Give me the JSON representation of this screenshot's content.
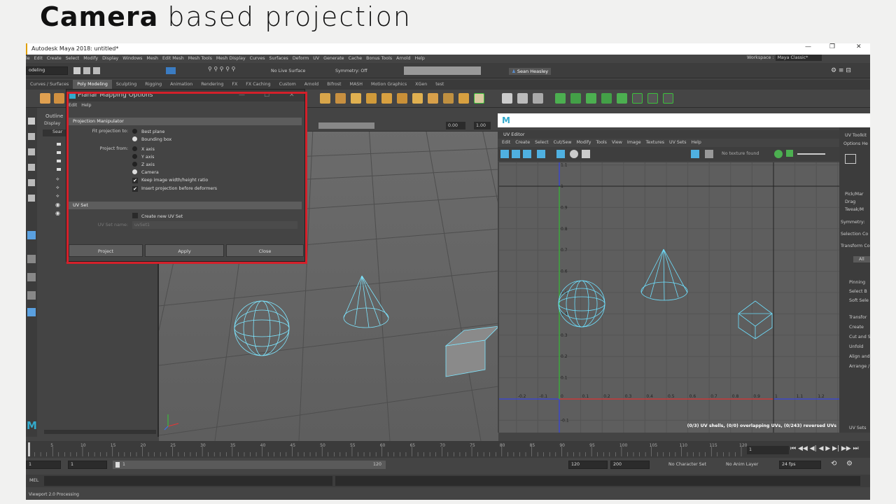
{
  "slide": {
    "title_bold": "Camera",
    "title_light": "based projection"
  },
  "window": {
    "title": "Autodesk Maya 2018: untitled*",
    "minimize": "—",
    "restore": "❐",
    "close": "✕"
  },
  "menus": [
    "le",
    "Edit",
    "Create",
    "Select",
    "Modify",
    "Display",
    "Windows",
    "Mesh",
    "Edit Mesh",
    "Mesh Tools",
    "Mesh Display",
    "Curves",
    "Surfaces",
    "Deform",
    "UV",
    "Generate",
    "Cache",
    "Bonus Tools",
    "Arnold",
    "Help"
  ],
  "workspace": {
    "label": "Workspace :",
    "value": "Maya Classic*"
  },
  "status": {
    "mode": "odeling",
    "live": "No Live Surface",
    "symmetry": "Symmetry: Off",
    "user": "Sean Heasley"
  },
  "shelf_tabs": [
    "Curves / Surfaces",
    "Poly Modeling",
    "Sculpting",
    "Rigging",
    "Animation",
    "Rendering",
    "FX",
    "FX Caching",
    "Custom",
    "Arnold",
    "Bifrost",
    "MASH",
    "Motion Graphics",
    "XGen",
    "test"
  ],
  "shelf_active": "Poly Modeling",
  "outliner": {
    "title": "Outline",
    "menu": "Display",
    "search": "Sear"
  },
  "viewport": {
    "field1": "0.00",
    "field2": "1.00"
  },
  "dialog": {
    "title": "Planar Mapping Options",
    "menu": [
      "Edit",
      "Help"
    ],
    "section1": "Projection Manipulator",
    "fit_label": "Fit projection to:",
    "fit_options": [
      "Best plane",
      "Bounding box"
    ],
    "project_label": "Project from:",
    "project_options": [
      "X axis",
      "Y axis",
      "Z axis",
      "Camera"
    ],
    "keep_ratio": "Keep image width/height ratio",
    "insert_proj": "Insert projection before deformers",
    "section2": "UV Set",
    "create_uv": "Create new UV Set",
    "uvset_label": "UV Set name:",
    "uvset_value": "uvSet1",
    "buttons": [
      "Project",
      "Apply",
      "Close"
    ]
  },
  "uv_editor": {
    "title": "UV Editor",
    "menu": [
      "Edit",
      "Create",
      "Select",
      "Cut/Sew",
      "Modify",
      "Tools",
      "View",
      "Image",
      "Textures",
      "UV Sets",
      "Help"
    ],
    "texture": "No texture found",
    "status": "(0/3) UV shells, (0/0) overlapping UVs, (0/243) reversed UVs",
    "x_ticks": [
      "-0.2",
      "-0.1",
      "0",
      "0.1",
      "0.2",
      "0.3",
      "0.4",
      "0.5",
      "0.6",
      "0.7",
      "0.8",
      "0.9",
      "1",
      "1.1",
      "1.2"
    ],
    "y_ticks": [
      "1.1",
      "1",
      "0.9",
      "0.8",
      "0.7",
      "0.6",
      "0.5",
      "0.4",
      "0.3",
      "0.2",
      "0.1",
      "-0.1"
    ]
  },
  "toolkit": {
    "title": "UV Toolkit",
    "menu": "Options He",
    "radios": [
      "Pick/Mar",
      "Drag",
      "Tweak/M"
    ],
    "labels": [
      "Symmetry:",
      "Selection Co",
      "Transform Co"
    ],
    "all": "All",
    "sections": [
      "Pinning",
      "Select B",
      "Soft Sele",
      "Transfor",
      "Create",
      "Cut and S",
      "Unfold",
      "Align and",
      "Arrange /"
    ],
    "footer": "UV Sets"
  },
  "timeline": {
    "ticks": [
      "5",
      "10",
      "15",
      "20",
      "25",
      "30",
      "35",
      "40",
      "45",
      "50",
      "55",
      "60",
      "65",
      "70",
      "75",
      "80",
      "85",
      "90",
      "95",
      "100",
      "105",
      "110",
      "115",
      "120"
    ],
    "current": "1"
  },
  "range": {
    "start": "1",
    "start2": "1",
    "slider_start": "1",
    "slider_end": "120",
    "end": "120",
    "end2": "200",
    "character": "No Character Set",
    "anim": "No Anim Layer",
    "fps": "24 fps"
  },
  "cmd": {
    "label": "MEL"
  },
  "help": "Viewport 2.0 Processing"
}
